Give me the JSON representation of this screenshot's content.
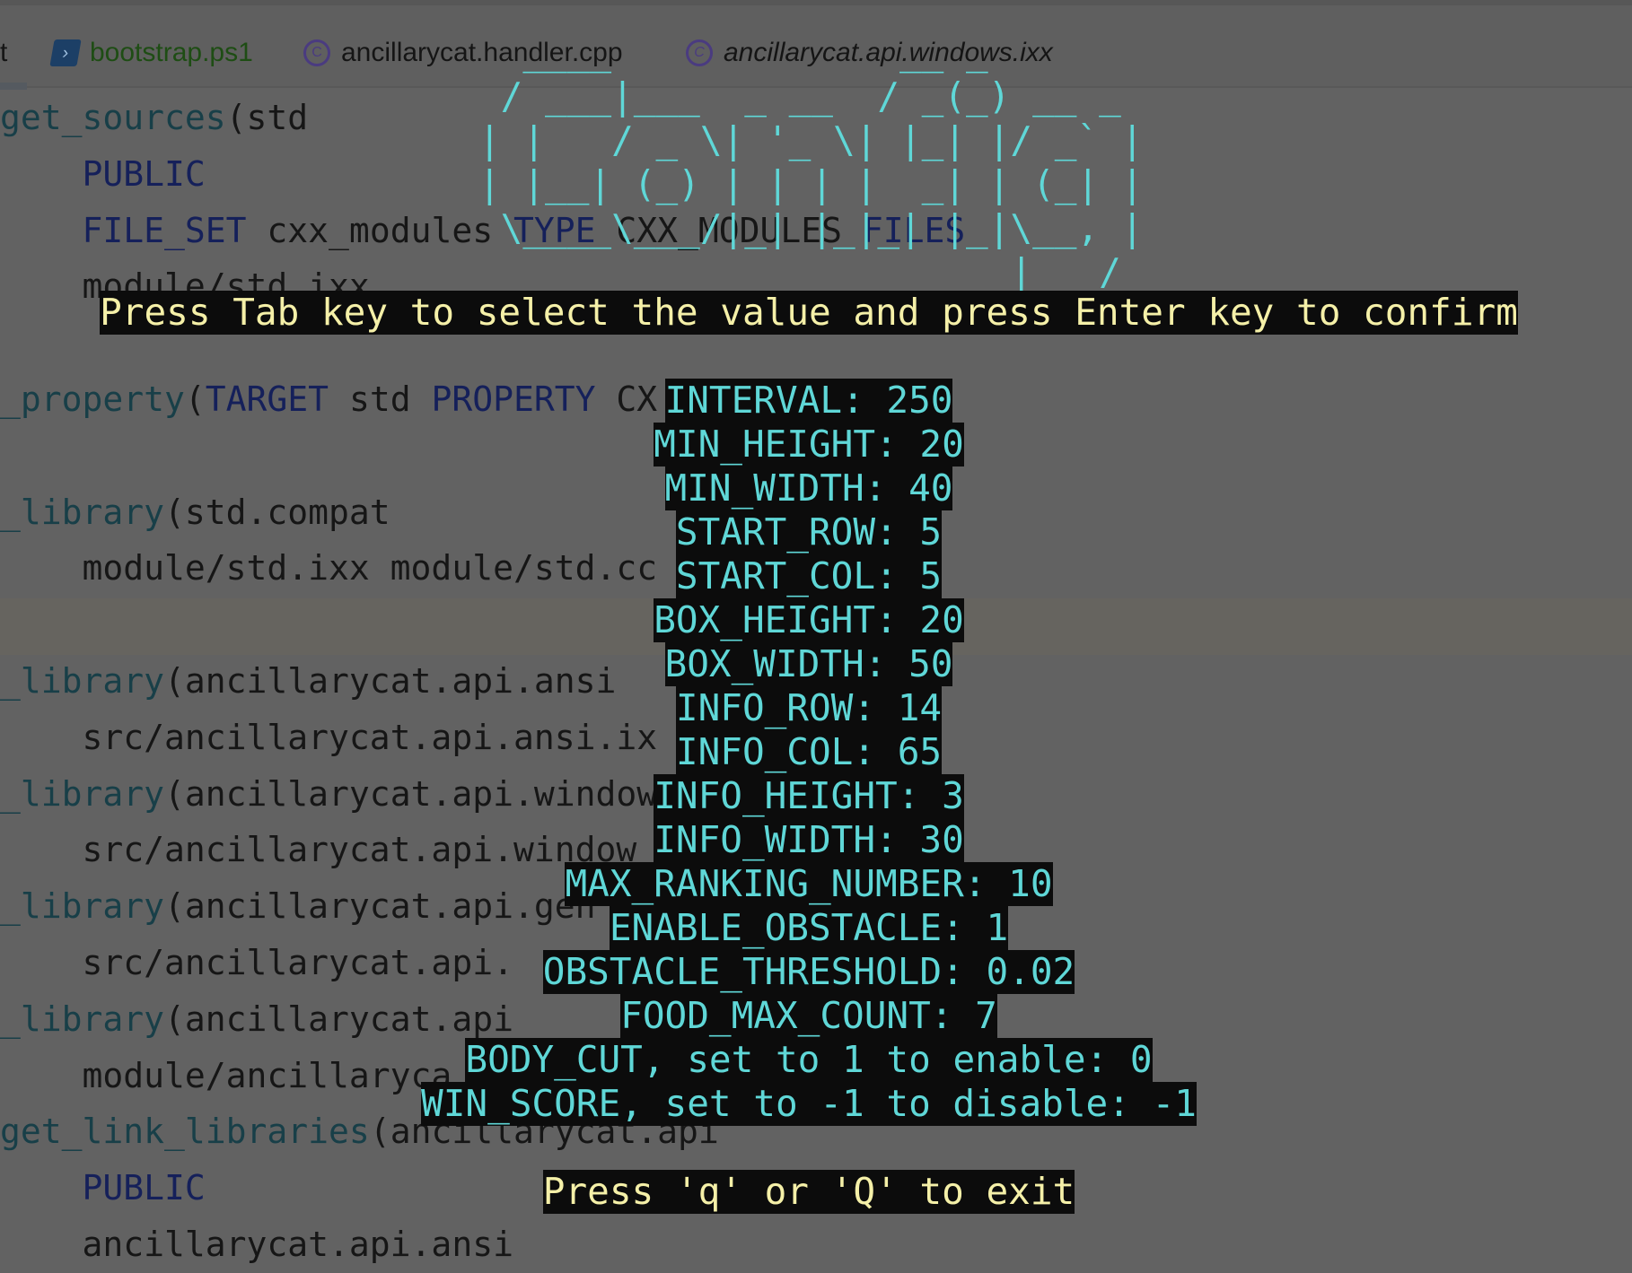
{
  "tabs": [
    {
      "label": "t",
      "icon": "file-icon",
      "active": true
    },
    {
      "label": "bootstrap.ps1",
      "icon": "powershell-icon",
      "color": "#1e4d14"
    },
    {
      "label": "ancillarycat.handler.cpp",
      "icon": "cpp-icon"
    },
    {
      "label": "ancillarycat.api.windows.ixx",
      "icon": "cpp-icon",
      "italic": true
    }
  ],
  "code_lines": [
    [
      [
        "fn",
        "get_sources"
      ],
      [
        "tx",
        "(std"
      ]
    ],
    [
      [
        "tx",
        "    "
      ],
      [
        "kw",
        "PUBLIC"
      ]
    ],
    [
      [
        "tx",
        "    "
      ],
      [
        "kw",
        "FILE_SET"
      ],
      [
        "tx",
        " cxx_modules "
      ],
      [
        "kw",
        "TYPE"
      ],
      [
        "tx",
        " CXX_MODULES "
      ],
      [
        "kw",
        "FILES"
      ]
    ],
    [
      [
        "tx",
        "    module/std.ixx"
      ]
    ],
    [],
    [
      [
        "fn",
        "_property"
      ],
      [
        "tx",
        "("
      ],
      [
        "kw",
        "TARGET"
      ],
      [
        "tx",
        " std "
      ],
      [
        "kw",
        "PROPERTY"
      ],
      [
        "tx",
        " CX"
      ]
    ],
    [],
    [
      [
        "fn",
        "_library"
      ],
      [
        "tx",
        "(std.compat"
      ]
    ],
    [
      [
        "tx",
        "    module/std.ixx module/std.cc"
      ]
    ],
    [],
    [
      [
        "fn",
        "_library"
      ],
      [
        "tx",
        "(ancillarycat.api.ansi"
      ]
    ],
    [
      [
        "tx",
        "    src/ancillarycat.api.ansi.ix"
      ]
    ],
    [
      [
        "fn",
        "_library"
      ],
      [
        "tx",
        "(ancillarycat.api.window"
      ]
    ],
    [
      [
        "tx",
        "    src/ancillarycat.api.window"
      ]
    ],
    [
      [
        "fn",
        "_library"
      ],
      [
        "tx",
        "(ancillarycat.api.gen"
      ]
    ],
    [
      [
        "tx",
        "    src/ancillarycat.api."
      ]
    ],
    [
      [
        "fn",
        "_library"
      ],
      [
        "tx",
        "(ancillarycat.api"
      ]
    ],
    [
      [
        "tx",
        "    module/ancillaryca"
      ]
    ],
    [
      [
        "fn",
        "get_link_libraries"
      ],
      [
        "tx",
        "(ancillarycat.api"
      ]
    ],
    [
      [
        "tx",
        "    "
      ],
      [
        "kw",
        "PUBLIC"
      ]
    ],
    [
      [
        "tx",
        "    ancillarycat.api.ansi"
      ]
    ]
  ],
  "terminal": {
    "ascii_art_text": "Config",
    "ascii_art": [
      "  ____             __ _       ",
      " / ___|___  _ __  / _(_) __ _ ",
      "| |   / _ \\| '_ \\| |_| |/ _` |",
      "| |__| (_) | | | |  _| | (_| |",
      " \\____\\___/|_| |_|_| |_|\\__, |",
      "                        |___/ "
    ],
    "instruction": "Press Tab key to select the value and press Enter key to confirm",
    "settings": [
      "INTERVAL: 250",
      "MIN_HEIGHT: 20",
      "MIN_WIDTH: 40",
      "START_ROW: 5",
      "START_COL: 5",
      "BOX_HEIGHT: 20",
      "BOX_WIDTH: 50",
      "INFO_ROW: 14",
      "INFO_COL: 65",
      "INFO_HEIGHT: 3",
      "INFO_WIDTH: 30",
      "MAX_RANKING_NUMBER: 10",
      "ENABLE_OBSTACLE: 1",
      "OBSTACLE_THRESHOLD: 0.02",
      "FOOD_MAX_COUNT: 7",
      "BODY_CUT, set to 1 to enable: 0",
      "WIN_SCORE, set to -1 to disable: -1"
    ],
    "exit_hint": "Press 'q' or 'Q' to exit",
    "colors": {
      "accent": "#5fd7d7",
      "hint": "#f5f0a8",
      "background": "#0c0c0c"
    }
  }
}
